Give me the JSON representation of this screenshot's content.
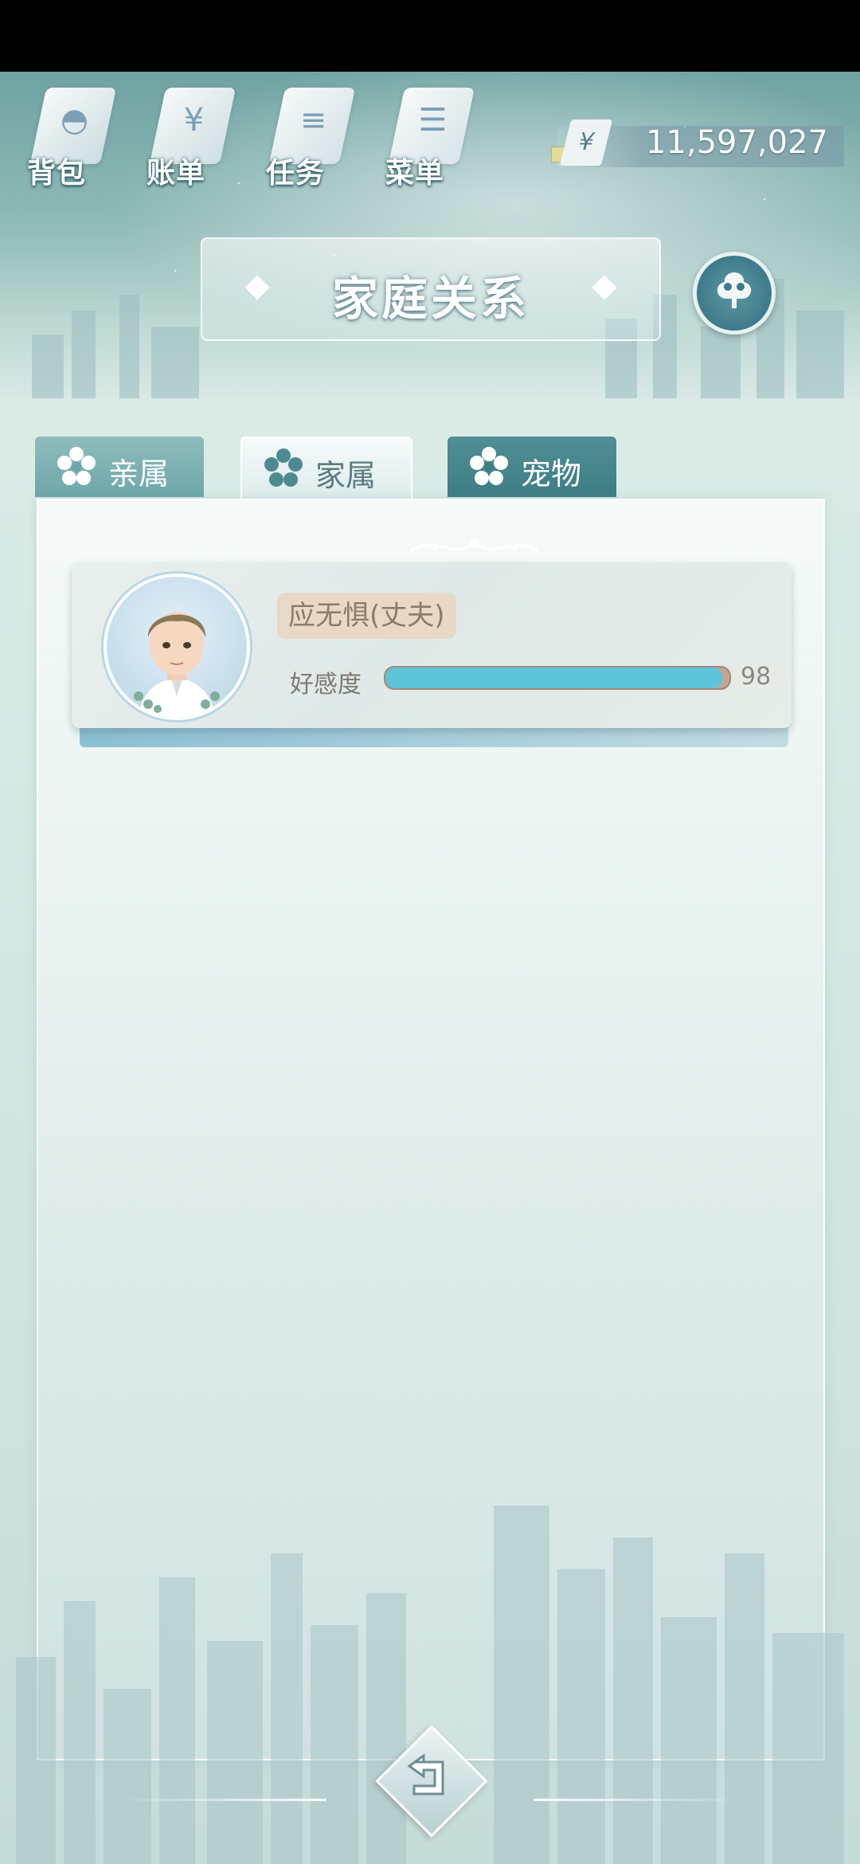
{
  "nav": {
    "items": [
      {
        "label": "背包",
        "icon": "bag-icon"
      },
      {
        "label": "账单",
        "icon": "bill-icon"
      },
      {
        "label": "任务",
        "icon": "task-icon"
      },
      {
        "label": "菜单",
        "icon": "menu-icon"
      }
    ]
  },
  "currency": {
    "symbol": "¥",
    "value": "11,597,027"
  },
  "page": {
    "title": "家庭关系"
  },
  "tabs": [
    {
      "label": "亲属",
      "icon": "flower-icon"
    },
    {
      "label": "家属",
      "icon": "flower-icon",
      "active": true
    },
    {
      "label": "宠物",
      "icon": "flower-icon"
    }
  ],
  "members": [
    {
      "name": "应无惧(丈夫)",
      "affinity_label": "好感度",
      "affinity_value": "98",
      "affinity_fraction": 0.98
    }
  ],
  "colors": {
    "accent": "#5ec4da",
    "tab_dark": "#3d7d84",
    "name_tag": "#e8d8c6"
  }
}
